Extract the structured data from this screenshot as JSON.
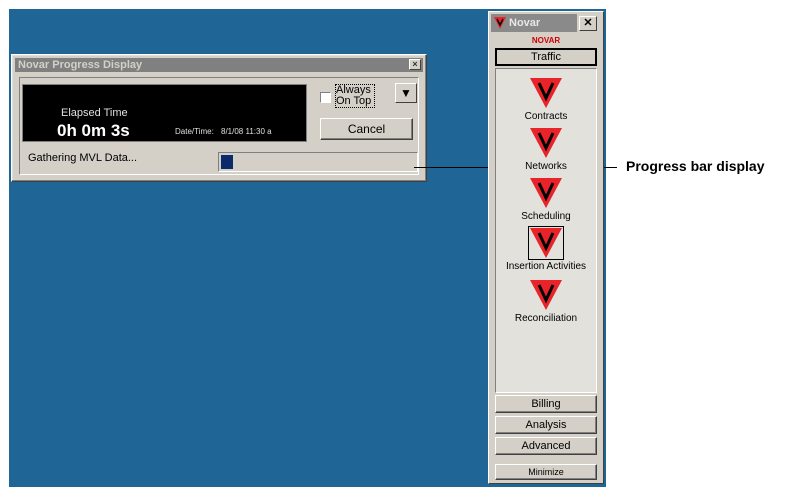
{
  "progress_dialog": {
    "title": "Novar Progress Display",
    "close_glyph": "×",
    "elapsed_label": "Elapsed Time",
    "elapsed_value": "0h 0m 3s",
    "datetime_label": "Date/Time:",
    "datetime_value": "8/1/08 11:30 a",
    "always_on_top_label": "Always On Top",
    "always_on_top_checked": false,
    "dropdown_glyph": "▼",
    "cancel_label": "Cancel",
    "status_text": "Gathering MVL Data...",
    "progress_fraction": 0.06
  },
  "annotation": {
    "label": "Progress bar display"
  },
  "novar_toolbar": {
    "title": "Novar",
    "close_glyph": "✕",
    "brand": "NOVAR",
    "traffic_button": "Traffic",
    "items": [
      {
        "label": "Contracts",
        "icon": "novar-v-icon"
      },
      {
        "label": "Networks",
        "icon": "novar-v-icon"
      },
      {
        "label": "Scheduling",
        "icon": "novar-v-icon"
      },
      {
        "label": "Insertion Activities",
        "icon": "novar-v-icon",
        "selected": true
      },
      {
        "label": "Reconciliation",
        "icon": "novar-v-icon"
      }
    ],
    "bottom_buttons": [
      "Billing",
      "Analysis",
      "Advanced"
    ],
    "minimize_label": "Minimize"
  },
  "colors": {
    "desktop": "#1f6696",
    "accent_red": "#e8232a",
    "progress_fill": "#0a2a6a"
  }
}
